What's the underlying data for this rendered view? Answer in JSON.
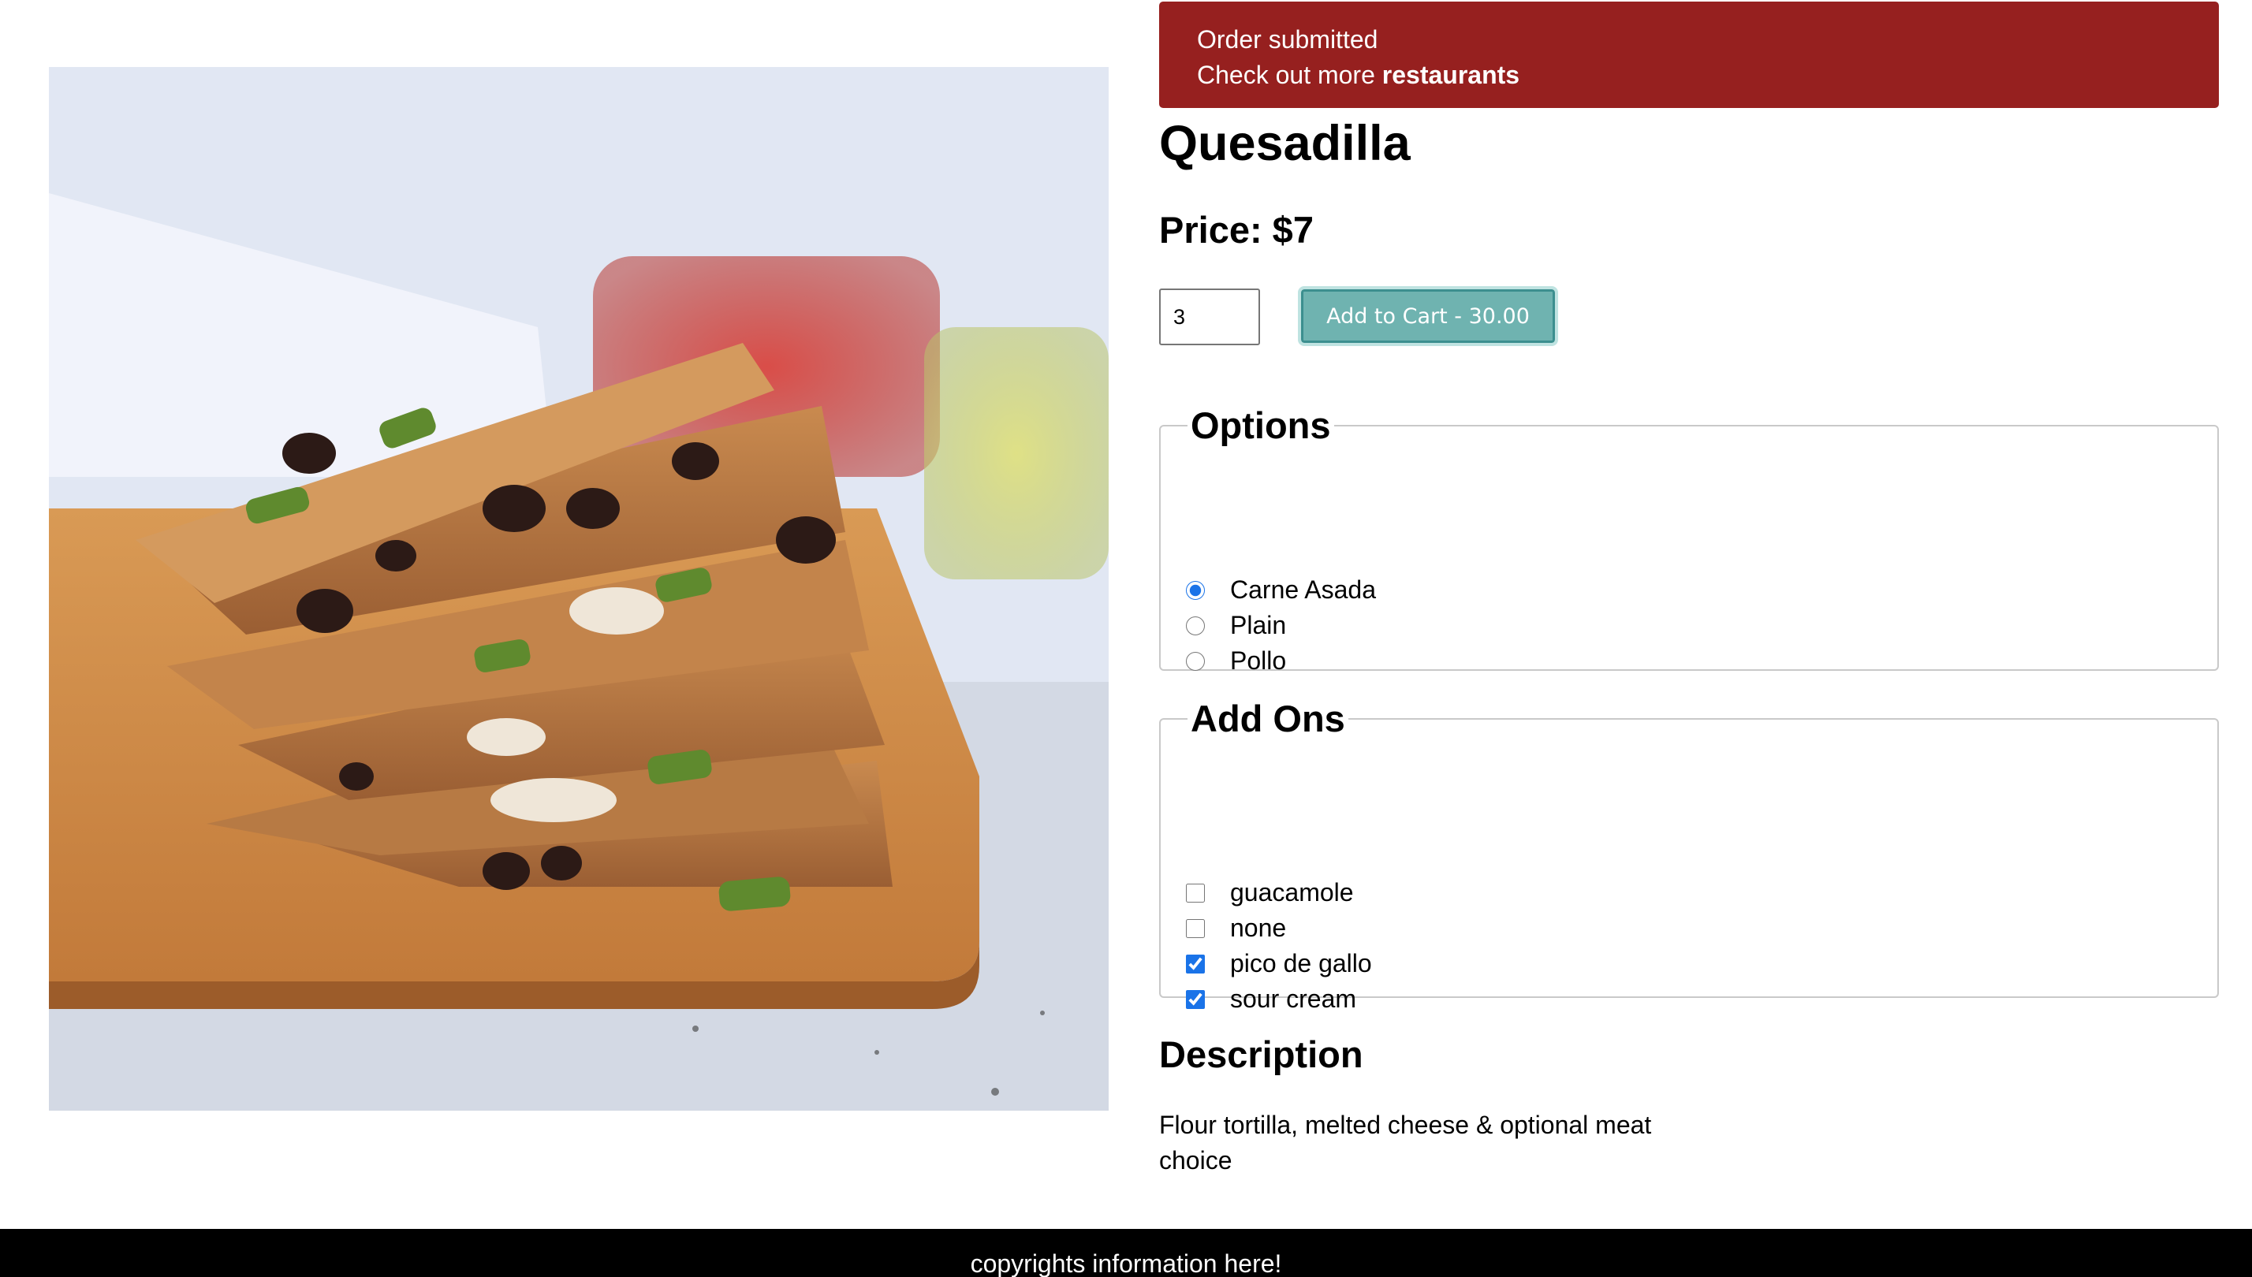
{
  "alert": {
    "line1": "Order submitted",
    "line2_prefix": "Check out more ",
    "line2_link": "restaurants",
    "color": "#96201f"
  },
  "product": {
    "image_alt": "quesadilla photo",
    "name": "Quesadilla",
    "price_label": "Price: $7",
    "quantity": "3",
    "add_to_cart_label": "Add to Cart - 30.00",
    "button_color": "#6fb3b0"
  },
  "options": {
    "legend": "Options",
    "items": [
      {
        "label": "Carne Asada",
        "checked": true
      },
      {
        "label": "Plain",
        "checked": false
      },
      {
        "label": "Pollo",
        "checked": false
      }
    ]
  },
  "addons": {
    "legend": "Add Ons",
    "items": [
      {
        "label": "guacamole",
        "checked": false
      },
      {
        "label": "none",
        "checked": false
      },
      {
        "label": "pico de gallo",
        "checked": true
      },
      {
        "label": "sour cream",
        "checked": true
      }
    ]
  },
  "description": {
    "heading": "Description",
    "text": "Flour tortilla, melted cheese & optional meat choice"
  },
  "footer": {
    "text": "copyrights information here!"
  }
}
